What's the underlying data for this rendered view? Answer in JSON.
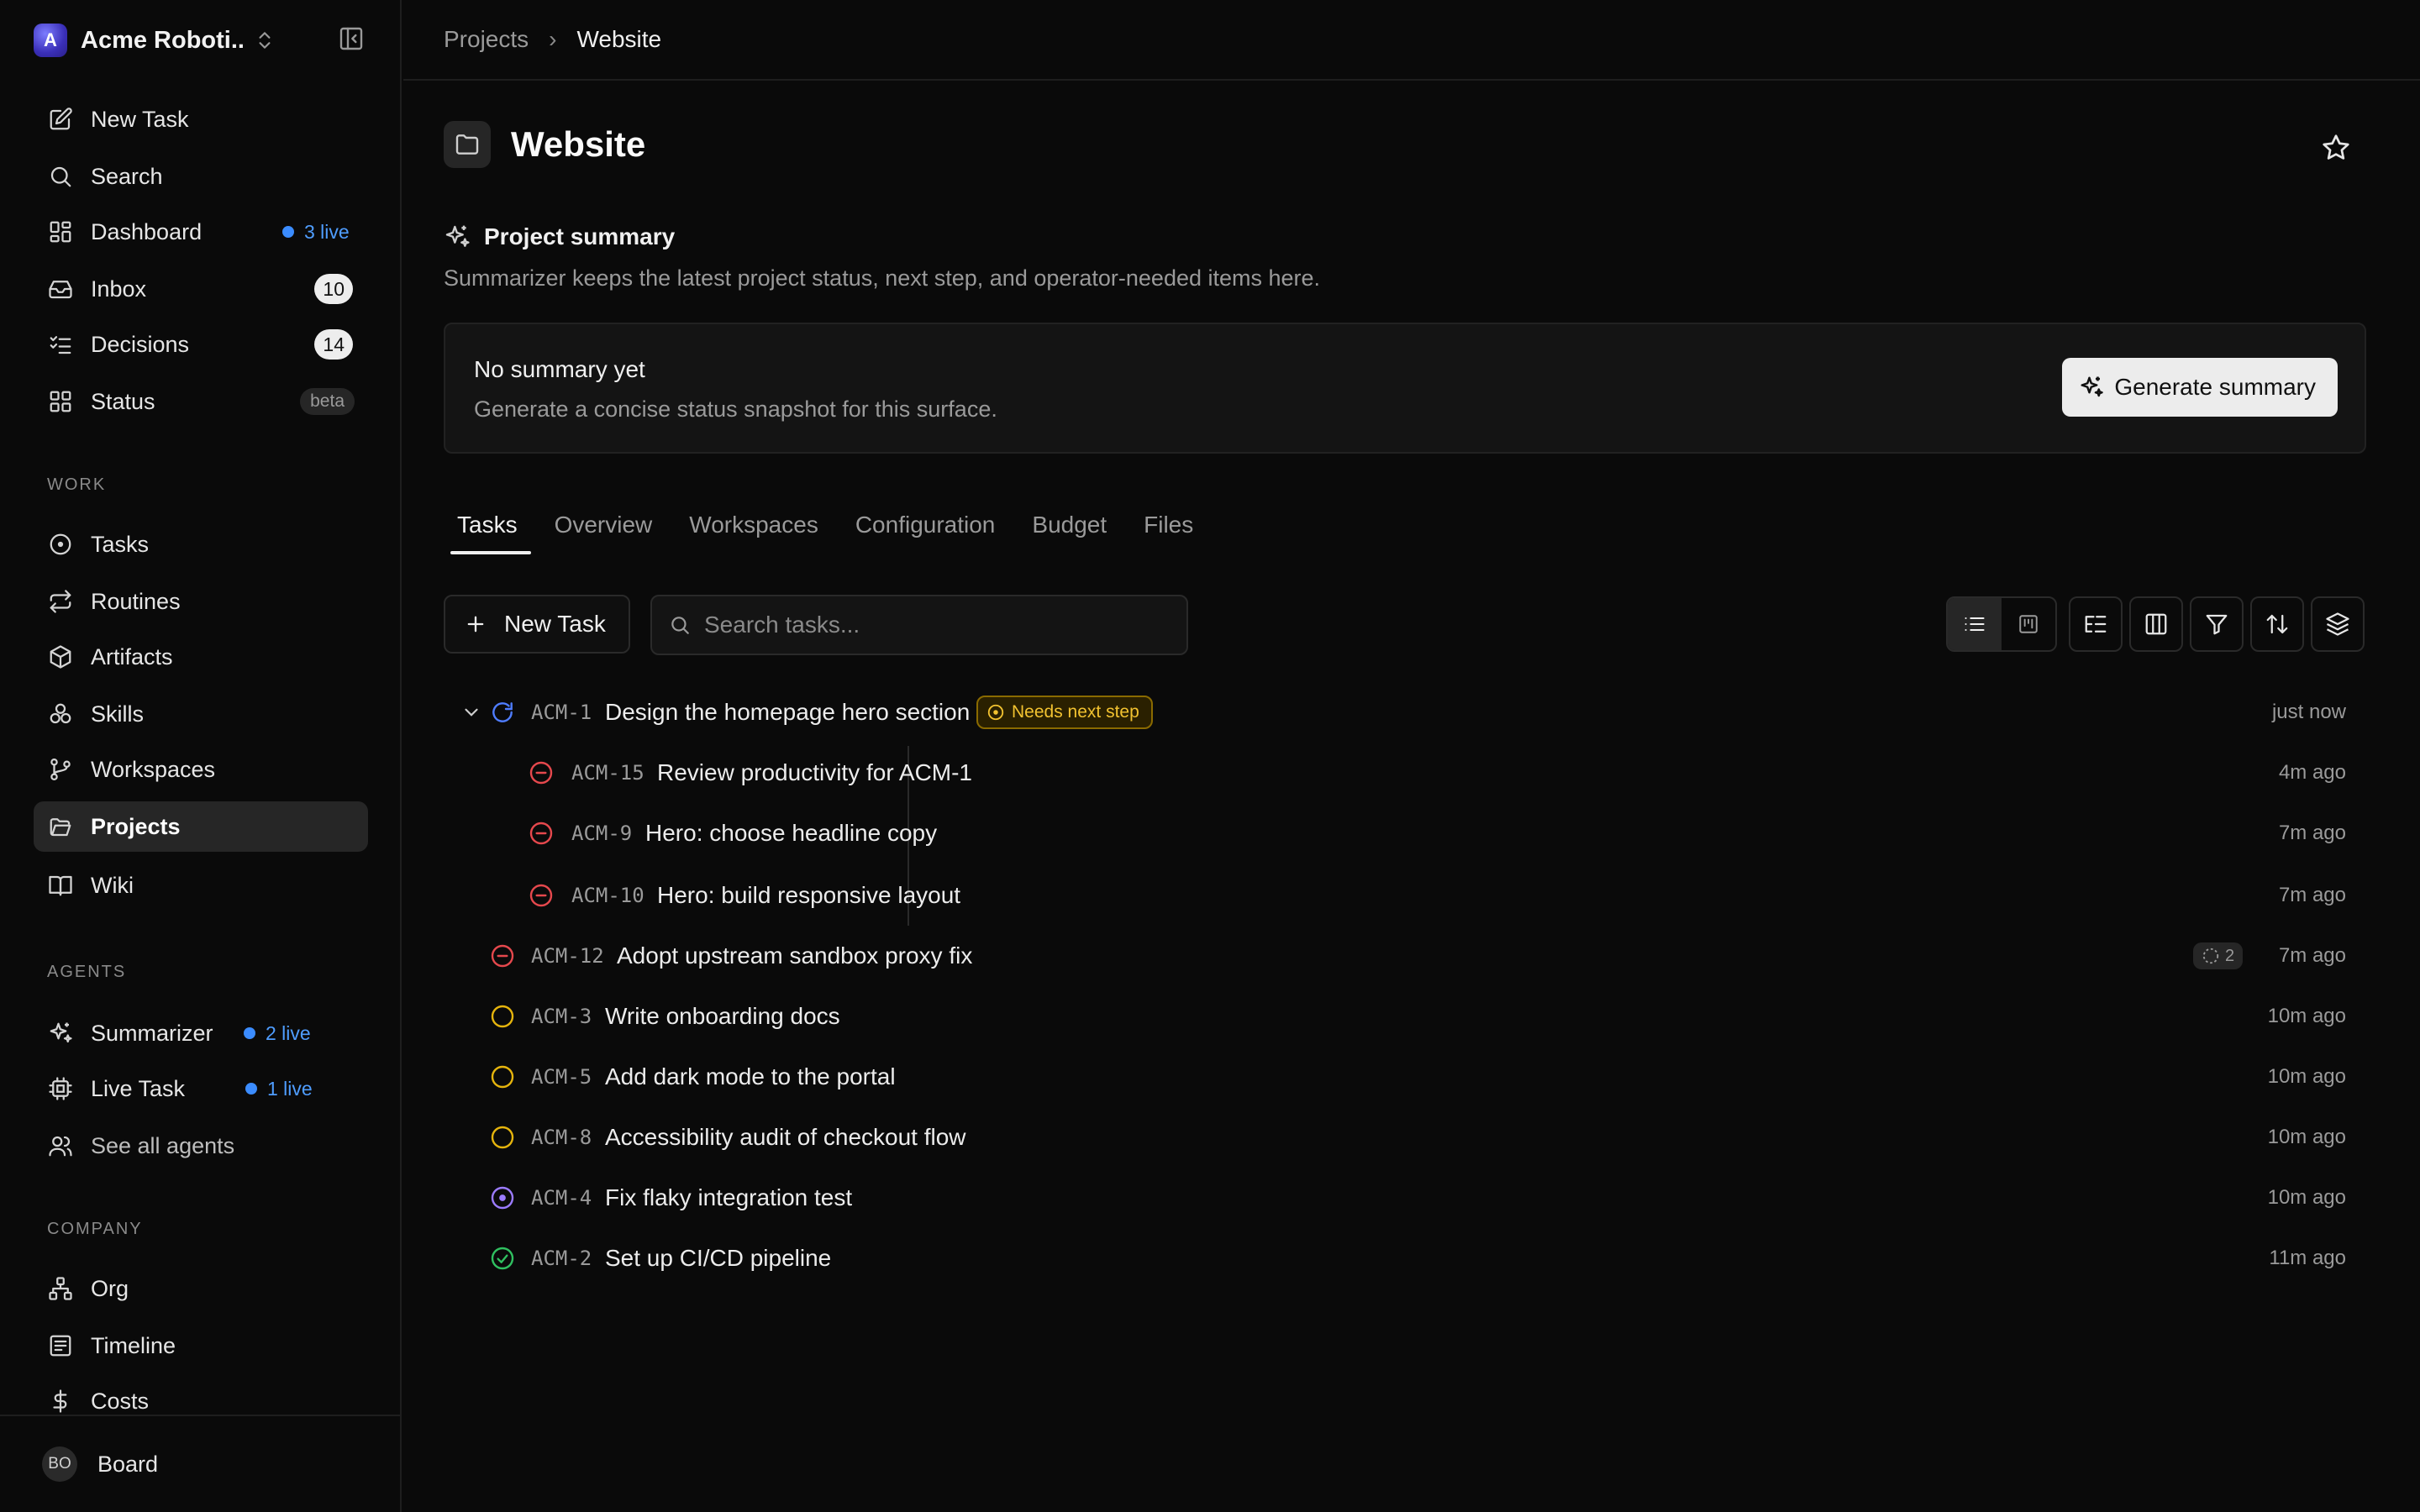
{
  "workspace": {
    "name": "Acme Roboti...",
    "logo_letter": "A"
  },
  "sidebar": {
    "top_items": [
      {
        "label": "New Task",
        "icon": "edit-icon"
      },
      {
        "label": "Search",
        "icon": "search-icon"
      },
      {
        "label": "Dashboard",
        "icon": "dashboard-icon",
        "live": "3 live"
      },
      {
        "label": "Inbox",
        "icon": "inbox-icon",
        "count": "10"
      },
      {
        "label": "Decisions",
        "icon": "checklist-icon",
        "count": "14"
      },
      {
        "label": "Status",
        "icon": "grid-icon",
        "tag": "beta"
      }
    ],
    "work_label": "WORK",
    "work_items": [
      {
        "label": "Tasks",
        "icon": "circle-dot-icon"
      },
      {
        "label": "Routines",
        "icon": "repeat-icon"
      },
      {
        "label": "Artifacts",
        "icon": "box-icon"
      },
      {
        "label": "Skills",
        "icon": "boxes-icon"
      },
      {
        "label": "Workspaces",
        "icon": "git-branch-icon"
      },
      {
        "label": "Projects",
        "icon": "folder-open-icon",
        "active": true
      },
      {
        "label": "Wiki",
        "icon": "book-icon"
      }
    ],
    "agents_label": "AGENTS",
    "agent_items": [
      {
        "label": "Summarizer",
        "icon": "sparkles-icon",
        "live": "2 live"
      },
      {
        "label": "Live Task",
        "icon": "cpu-icon",
        "live": "1 live"
      },
      {
        "label": "See all agents",
        "icon": "users-icon"
      }
    ],
    "company_label": "COMPANY",
    "company_items": [
      {
        "label": "Org",
        "icon": "org-chart-icon"
      },
      {
        "label": "Timeline",
        "icon": "timeline-icon"
      },
      {
        "label": "Costs",
        "icon": "dollar-icon"
      }
    ],
    "footer": {
      "avatar": "BO",
      "label": "Board"
    }
  },
  "breadcrumb": {
    "parent": "Projects",
    "separator": "›",
    "current": "Website"
  },
  "project": {
    "title": "Website"
  },
  "summary": {
    "heading": "Project summary",
    "description": "Summarizer keeps the latest project status, next step, and operator-needed items here.",
    "empty_title": "No summary yet",
    "empty_description": "Generate a concise status snapshot for this surface.",
    "generate_label": "Generate summary"
  },
  "tabs": [
    "Tasks",
    "Overview",
    "Workspaces",
    "Configuration",
    "Budget",
    "Files"
  ],
  "active_tab": "Tasks",
  "toolbar": {
    "new_task_label": "New Task",
    "search_placeholder": "Search tasks..."
  },
  "tasks": [
    {
      "id": "ACM-1",
      "title": "Design the homepage hero section",
      "status": "in-progress",
      "badge": "Needs next step",
      "time": "just now",
      "expanded": true
    },
    {
      "id": "ACM-15",
      "title": "Review productivity for ACM-1",
      "status": "blocked",
      "time": "4m ago",
      "child": true
    },
    {
      "id": "ACM-9",
      "title": "Hero: choose headline copy",
      "status": "blocked",
      "time": "7m ago",
      "child": true
    },
    {
      "id": "ACM-10",
      "title": "Hero: build responsive layout",
      "status": "blocked",
      "time": "7m ago",
      "child": true
    },
    {
      "id": "ACM-12",
      "title": "Adopt upstream sandbox proxy fix",
      "status": "blocked",
      "runs": "2",
      "time": "7m ago"
    },
    {
      "id": "ACM-3",
      "title": "Write onboarding docs",
      "status": "todo",
      "time": "10m ago"
    },
    {
      "id": "ACM-5",
      "title": "Add dark mode to the portal",
      "status": "todo",
      "time": "10m ago"
    },
    {
      "id": "ACM-8",
      "title": "Accessibility audit of checkout flow",
      "status": "todo",
      "time": "10m ago"
    },
    {
      "id": "ACM-4",
      "title": "Fix flaky integration test",
      "status": "in-review",
      "time": "10m ago"
    },
    {
      "id": "ACM-2",
      "title": "Set up CI/CD pipeline",
      "status": "done",
      "time": "11m ago"
    }
  ],
  "colors": {
    "background": "#0a0a0a",
    "live_blue": "#3b8cff",
    "blocked_red": "#e5484d",
    "todo_amber": "#e5b40d",
    "in_progress_blue": "#4f7dff",
    "in_review_purple": "#9b7bff",
    "done_green": "#30c060",
    "badge_amber": "#f2c230"
  }
}
